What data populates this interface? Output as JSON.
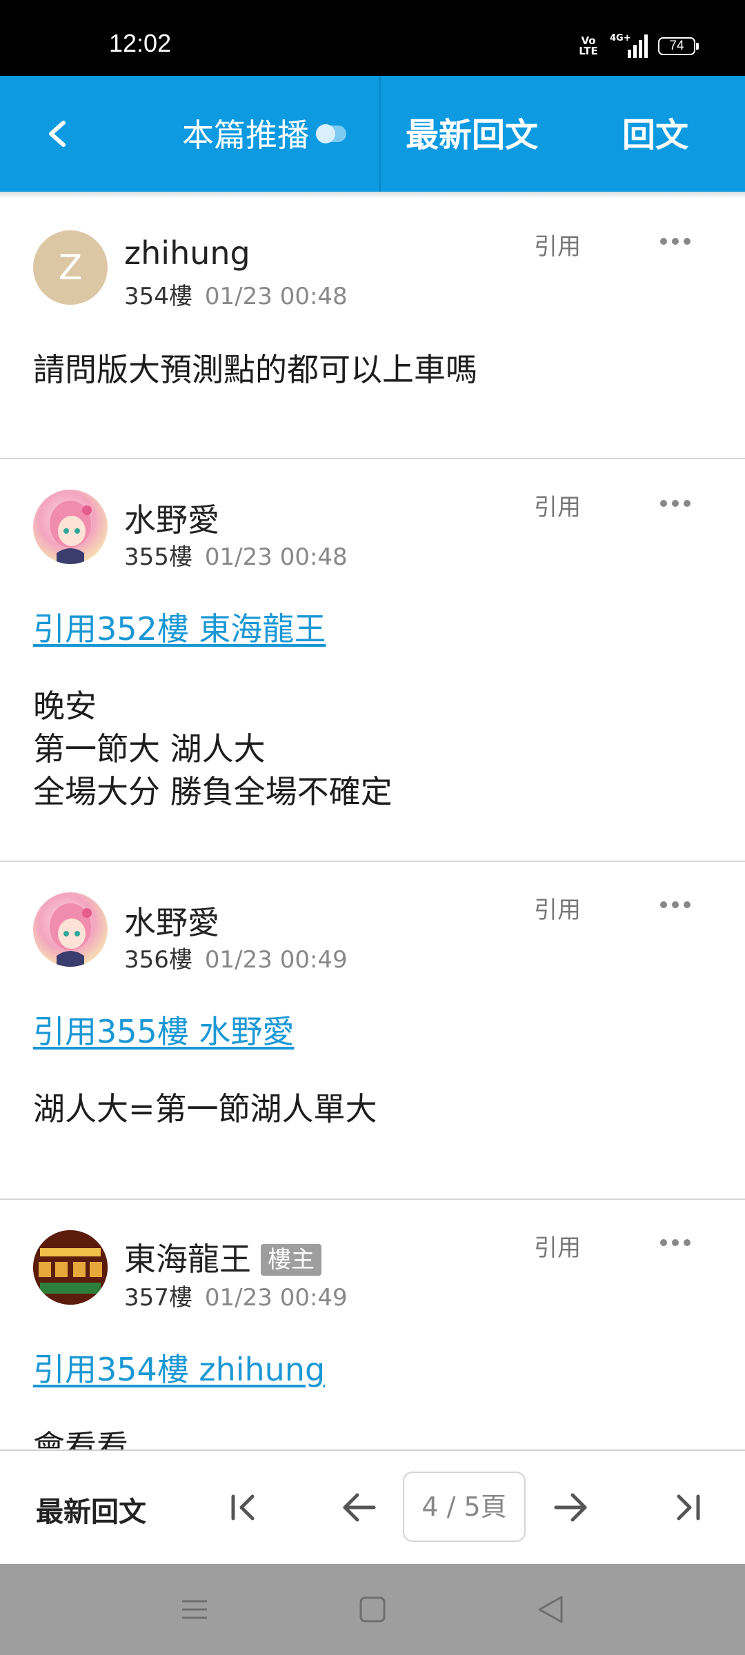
{
  "status_bar": {
    "time": "12:02",
    "volte": "Vo\nLTE",
    "network": "4G+",
    "battery": "74"
  },
  "app_bar": {
    "push_label": "本篇推播",
    "latest_label": "最新回文",
    "reply_label": "回文",
    "accent": "#0d9ae0"
  },
  "posts": [
    {
      "avatar_letter": "Z",
      "author": "zhihung",
      "floor": "354樓",
      "time": "01/23 00:48",
      "quote_label": "引用",
      "body": [
        "請問版大預測點的都可以上車嗎"
      ]
    },
    {
      "author": "水野愛",
      "floor": "355樓",
      "time": "01/23 00:48",
      "quote_label": "引用",
      "quote_link": "引用352樓 東海龍王",
      "body": [
        "晚安",
        "第一節大 湖人大",
        "全場大分 勝負全場不確定"
      ]
    },
    {
      "author": "水野愛",
      "floor": "356樓",
      "time": "01/23 00:49",
      "quote_label": "引用",
      "quote_link": "引用355樓 水野愛",
      "body": [
        "湖人大=第一節湖人單大"
      ]
    },
    {
      "author": "東海龍王",
      "badge": "樓主",
      "floor": "357樓",
      "time": "01/23 00:49",
      "quote_label": "引用",
      "quote_link": "引用354樓 zhihung",
      "body": [
        "會看看"
      ]
    }
  ],
  "pager": {
    "latest_label": "最新回文",
    "page_indicator": "4 / 5頁"
  },
  "icons": {
    "back": "chevron-left-icon",
    "toggle": "toggle-icon",
    "more": "more-horizontal-icon",
    "first": "first-page-icon",
    "prev": "arrow-left-icon",
    "next": "arrow-right-icon",
    "last": "last-page-icon",
    "menu": "menu-icon",
    "home": "home-icon",
    "nav_back": "nav-back-icon"
  }
}
